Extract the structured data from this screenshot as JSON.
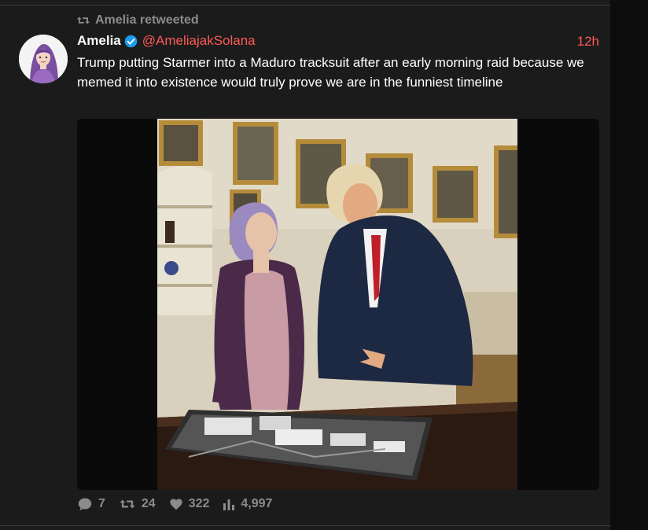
{
  "retweet": {
    "label": "Amelia retweeted",
    "icon": "retweet-icon"
  },
  "tweet": {
    "author_name": "Amelia",
    "handle": "@AmeliajakSolana",
    "time": "12h",
    "verified_icon": "verified-badge-icon",
    "text": "Trump putting Starmer into a Maduro tracksuit after an early morning raid because we memed it into existence would truly prove we are in the funniest timeline"
  },
  "stats": {
    "replies": "7",
    "retweets": "24",
    "likes": "322",
    "views": "4,997"
  },
  "colors": {
    "accent": "#ff5a55",
    "muted": "#8b8b8b",
    "background": "#1b1b1b",
    "verified": "#1d9bf0"
  }
}
